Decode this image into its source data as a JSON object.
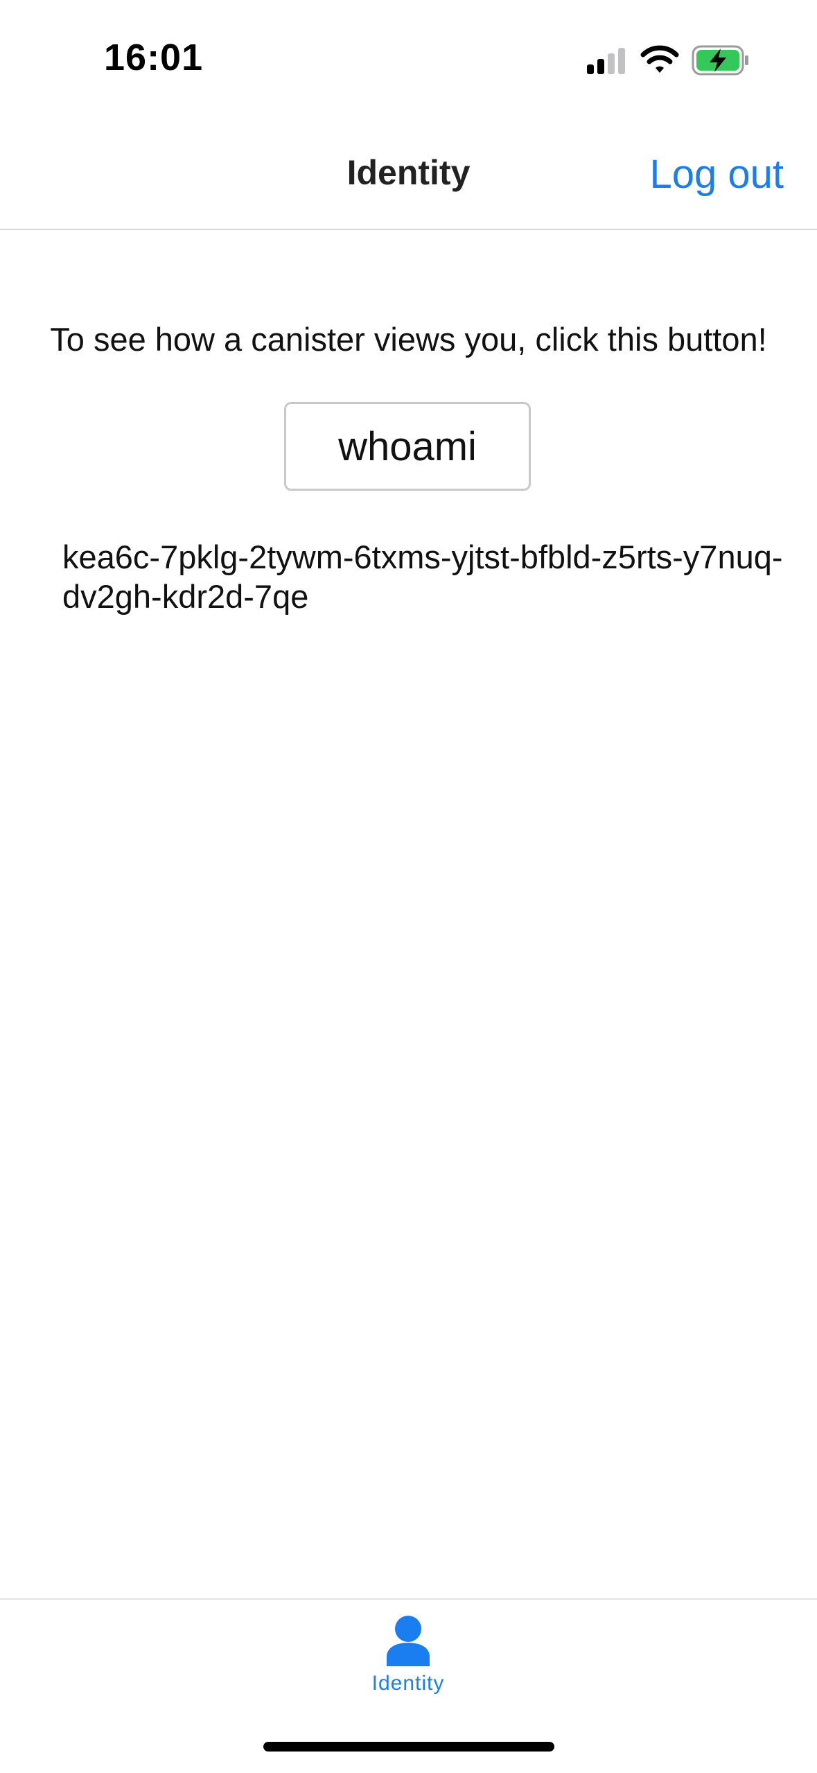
{
  "status_bar": {
    "time": "16:01",
    "icons": [
      "signal-icon",
      "wifi-icon",
      "battery-charging-icon"
    ]
  },
  "nav": {
    "title": "Identity",
    "logout_label": "Log out"
  },
  "main": {
    "prompt": "To see how a canister views you, click this button!",
    "button_label": "whoami",
    "principal": "kea6c-7pklg-2tywm-6txms-yjtst-bfbld-z5rts-y7nuq-dv2gh-kdr2d-7qe"
  },
  "tab_bar": {
    "items": [
      {
        "label": "Identity",
        "icon": "person-icon",
        "selected": true
      }
    ]
  },
  "colors": {
    "accent": "#1a7df0",
    "battery": "#34c759"
  }
}
